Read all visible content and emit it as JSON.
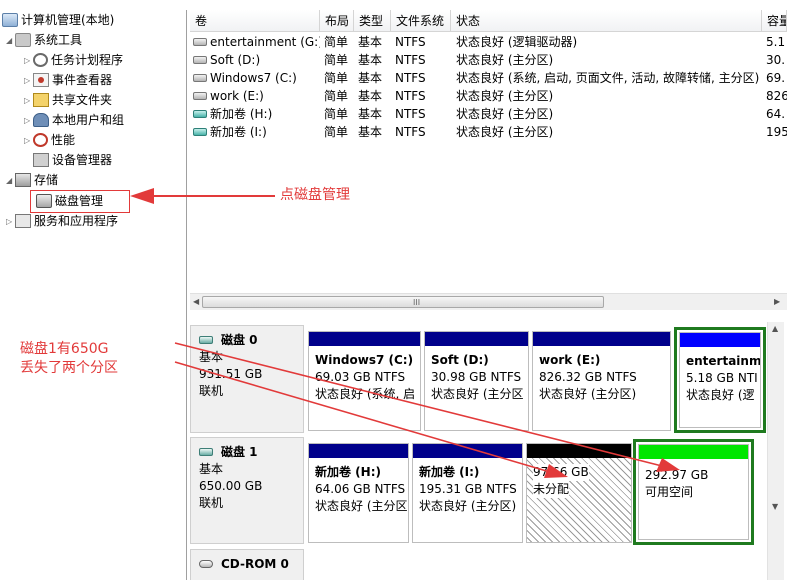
{
  "tree": {
    "root": "计算机管理(本地)",
    "system_tools": "系统工具",
    "task_scheduler": "任务计划程序",
    "event_viewer": "事件查看器",
    "shared_folders": "共享文件夹",
    "local_users": "本地用户和组",
    "performance": "性能",
    "device_manager": "设备管理器",
    "storage": "存储",
    "disk_management": "磁盘管理",
    "services_apps": "服务和应用程序"
  },
  "volumes": {
    "headers": [
      "卷",
      "布局",
      "类型",
      "文件系统",
      "状态",
      "容量"
    ],
    "rows": [
      {
        "name": "entertainment (G:)",
        "layout": "简单",
        "type": "基本",
        "fs": "NTFS",
        "status": "状态良好 (逻辑驱动器)",
        "capacity": "5.1"
      },
      {
        "name": "Soft (D:)",
        "layout": "简单",
        "type": "基本",
        "fs": "NTFS",
        "status": "状态良好 (主分区)",
        "capacity": "30."
      },
      {
        "name": "Windows7 (C:)",
        "layout": "简单",
        "type": "基本",
        "fs": "NTFS",
        "status": "状态良好 (系统, 启动, 页面文件, 活动, 故障转储, 主分区)",
        "capacity": "69."
      },
      {
        "name": "work (E:)",
        "layout": "简单",
        "type": "基本",
        "fs": "NTFS",
        "status": "状态良好 (主分区)",
        "capacity": "826"
      },
      {
        "name": "新加卷 (H:)",
        "layout": "简单",
        "type": "基本",
        "fs": "NTFS",
        "status": "状态良好 (主分区)",
        "capacity": "64."
      },
      {
        "name": "新加卷 (I:)",
        "layout": "简单",
        "type": "基本",
        "fs": "NTFS",
        "status": "状态良好 (主分区)",
        "capacity": "195"
      }
    ],
    "scroll_grip": "III"
  },
  "disk0": {
    "title": "磁盘 0",
    "type": "基本",
    "size": "931.51 GB",
    "state": "联机",
    "parts": [
      {
        "name": "Windows7  (C:)",
        "size": "69.03 GB NTFS",
        "status": "状态良好 (系统, 启"
      },
      {
        "name": "Soft  (D:)",
        "size": "30.98 GB NTFS",
        "status": "状态良好 (主分区"
      },
      {
        "name": "work  (E:)",
        "size": "826.32 GB NTFS",
        "status": "状态良好 (主分区)"
      },
      {
        "name": "entertainm",
        "size": "5.18 GB NTI",
        "status": "状态良好 (逻"
      }
    ]
  },
  "disk1": {
    "title": "磁盘 1",
    "type": "基本",
    "size": "650.00 GB",
    "state": "联机",
    "parts": [
      {
        "name": "新加卷  (H:)",
        "size": "64.06 GB NTFS",
        "status": "状态良好 (主分区"
      },
      {
        "name": "新加卷  (I:)",
        "size": "195.31 GB NTFS",
        "status": "状态良好 (主分区)"
      },
      {
        "size": "97.66 GB",
        "status": "未分配"
      },
      {
        "size": "292.97 GB",
        "status": "可用空间"
      }
    ]
  },
  "cdrom": {
    "title": "CD-ROM 0"
  },
  "annotations": {
    "click_disk_mgmt": "点磁盘管理",
    "note_line1": "磁盘1有650G",
    "note_line2": "丢失了两个分区"
  },
  "colors": {
    "primary_bar": "#00008b",
    "logical_bar": "#0000ff",
    "unallocated_bar": "#000000",
    "free_bar": "#00e600",
    "selection_frame": "#1f7a1f",
    "annotation": "#e23a3a"
  }
}
